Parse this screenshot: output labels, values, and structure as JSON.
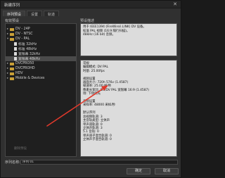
{
  "window": {
    "title": "新建序列",
    "close_glyph": "✕"
  },
  "tabs": [
    {
      "label": "序列预设",
      "active": true
    },
    {
      "label": "设置",
      "active": false
    },
    {
      "label": "轨道",
      "active": false
    }
  ],
  "left_panel": {
    "title": "有效预设",
    "tree": [
      {
        "label": "DV - 24P",
        "type": "folder",
        "expanded": false,
        "selected": false
      },
      {
        "label": "DV - NTSC",
        "type": "folder",
        "expanded": false,
        "selected": false
      },
      {
        "label": "DV - PAL",
        "type": "folder",
        "expanded": true,
        "selected": false
      },
      {
        "label": "标准 32kHz",
        "type": "file",
        "selected": false
      },
      {
        "label": "标准 48kHz",
        "type": "file",
        "selected": false
      },
      {
        "label": "宽银幕 32kHz",
        "type": "file",
        "selected": false
      },
      {
        "label": "宽银幕 48kHz",
        "type": "file",
        "selected": true
      },
      {
        "label": "DVCPRO50",
        "type": "folder",
        "expanded": false,
        "selected": false
      },
      {
        "label": "DVCPROHD",
        "type": "folder",
        "expanded": false,
        "selected": false
      },
      {
        "label": "HDV",
        "type": "folder",
        "expanded": false,
        "selected": false
      },
      {
        "label": "Mobile & Devices",
        "type": "folder",
        "expanded": false,
        "selected": false
      }
    ],
    "delete_button": "删除预设"
  },
  "right_panel": {
    "title": "预设描述",
    "description": [
      "用于 IEEE1394 (FireWire/i.LINK) DV 设备。",
      "标准 PAL 视频 (16:9 隔行扫描)。",
      "48kHz (16 bit) 音频。"
    ],
    "details": [
      "常规",
      "  编辑模式: DV PAL",
      "  时基: 25.00fps",
      "",
      "视频设置",
      "  画面大小: 720h 576v (1.4587)",
      "  帧速率: 25.00 帧/秒",
      "  像素长宽比: D1/DV PAL 宽银幕 16:9 (1.4587)",
      "  场: 下场优先",
      "",
      "音频设置",
      "  采样率: 48000 采样/秒",
      "",
      "默认序列",
      "  总视频轨道: 3",
      "  主音轨类型: 立体声",
      "  单声道轨道: 0",
      "  立体声轨道: 3",
      "  5.1 音轨: 0",
      "  单声道子混合轨道: 0",
      "  立体声子混合轨道: 0"
    ]
  },
  "sequence_name": {
    "label": "序列名称:",
    "value": "序列 01"
  },
  "buttons": {
    "ok": "确定",
    "cancel": "取消"
  },
  "annotation_color": "#e0392b"
}
